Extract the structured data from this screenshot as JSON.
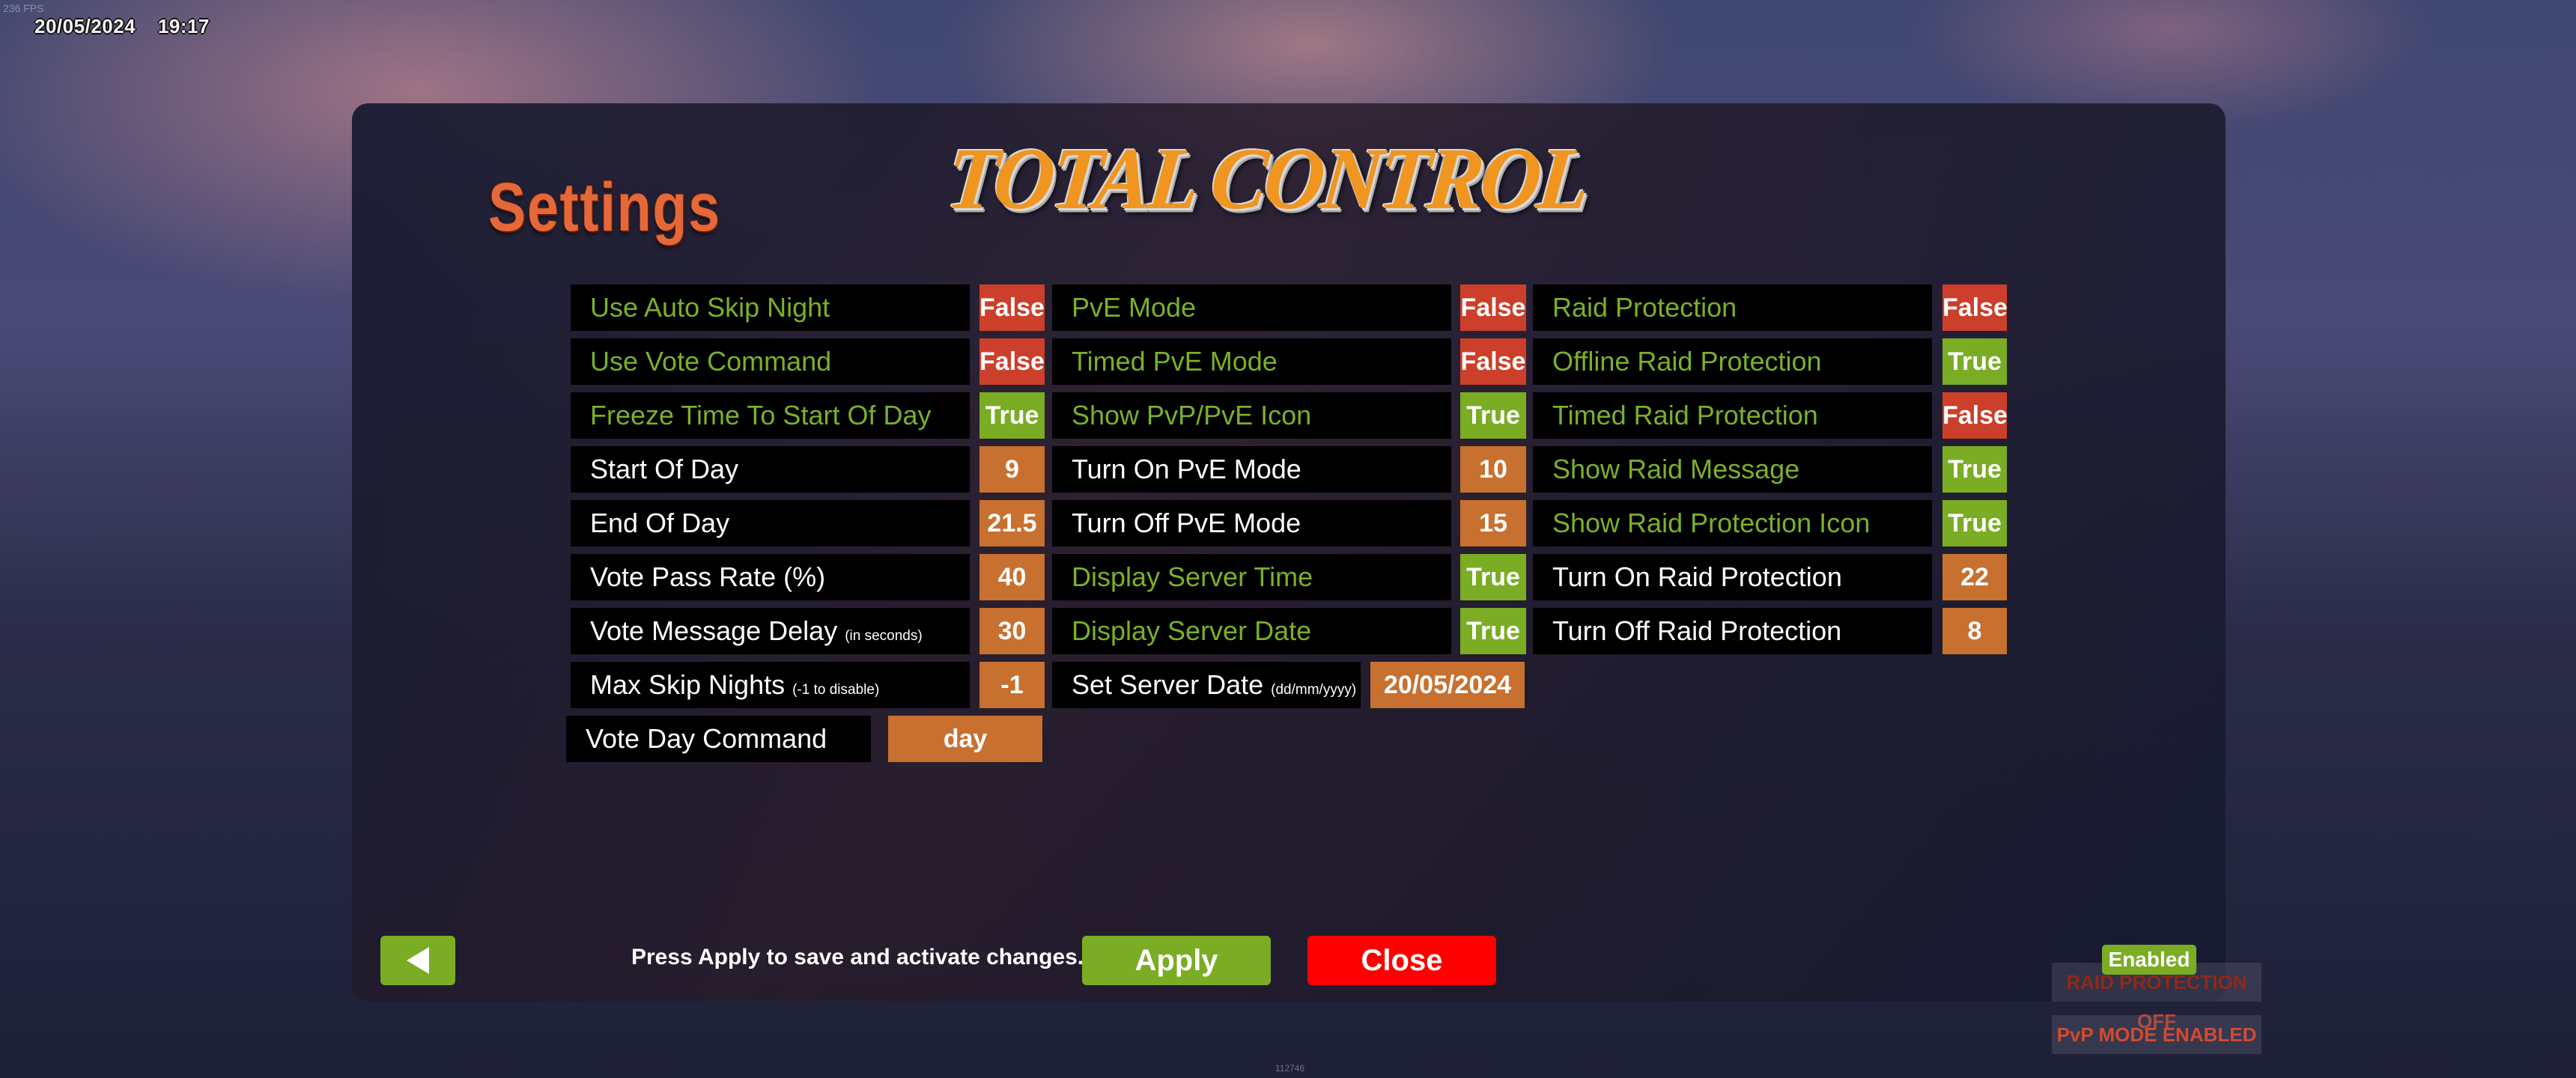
{
  "hud": {
    "fps": "236 FPS",
    "date": "20/05/2024",
    "time": "19:17"
  },
  "panel": {
    "title": "Settings",
    "logo": "TOTAL CONTROL"
  },
  "columns": [
    {
      "rows": [
        {
          "label": "Use Auto Skip Night",
          "value": "False",
          "kind": "false",
          "label_color": "green"
        },
        {
          "label": "Use Vote Command",
          "value": "False",
          "kind": "false",
          "label_color": "green"
        },
        {
          "label": "Freeze Time To Start Of Day",
          "value": "True",
          "kind": "true",
          "label_color": "green"
        },
        {
          "label": "Start Of Day",
          "value": "9",
          "kind": "num",
          "label_color": "white"
        },
        {
          "label": "End Of Day",
          "value": "21.5",
          "kind": "num",
          "label_color": "white"
        },
        {
          "label": "Vote Pass Rate (%)",
          "value": "40",
          "kind": "num",
          "label_color": "white"
        },
        {
          "label": "Vote Message Delay",
          "note": "(in seconds)",
          "value": "30",
          "kind": "num",
          "label_color": "white"
        },
        {
          "label": "Max Skip Nights",
          "note": "(-1 to disable)",
          "value": "-1",
          "kind": "num",
          "label_color": "white"
        }
      ],
      "wide_row": {
        "label": "Vote Day Command",
        "value": "day"
      }
    },
    {
      "rows": [
        {
          "label": "PvE Mode",
          "value": "False",
          "kind": "false",
          "label_color": "green"
        },
        {
          "label": "Timed PvE Mode",
          "value": "False",
          "kind": "false",
          "label_color": "green"
        },
        {
          "label": "Show PvP/PvE Icon",
          "value": "True",
          "kind": "true",
          "label_color": "green"
        },
        {
          "label": "Turn On PvE Mode",
          "value": "10",
          "kind": "num",
          "label_color": "white"
        },
        {
          "label": "Turn Off PvE Mode",
          "value": "15",
          "kind": "num",
          "label_color": "white"
        },
        {
          "label": "Display Server Time",
          "value": "True",
          "kind": "true",
          "label_color": "green"
        },
        {
          "label": "Display Server Date",
          "value": "True",
          "kind": "true",
          "label_color": "green"
        }
      ],
      "wide_row": {
        "label": "Set Server Date",
        "note": "(dd/mm/yyyy)",
        "value": "20/05/2024"
      }
    },
    {
      "rows": [
        {
          "label": "Raid Protection",
          "value": "False",
          "kind": "false",
          "label_color": "green"
        },
        {
          "label": "Offline Raid Protection",
          "value": "True",
          "kind": "true",
          "label_color": "green"
        },
        {
          "label": "Timed Raid Protection",
          "value": "False",
          "kind": "false",
          "label_color": "green"
        },
        {
          "label": "Show Raid Message",
          "value": "True",
          "kind": "true",
          "label_color": "green"
        },
        {
          "label": "Show Raid Protection Icon",
          "value": "True",
          "kind": "true",
          "label_color": "green"
        },
        {
          "label": "Turn On Raid Protection",
          "value": "22",
          "kind": "num",
          "label_color": "white"
        },
        {
          "label": "Turn Off Raid Protection",
          "value": "8",
          "kind": "num",
          "label_color": "white"
        }
      ]
    }
  ],
  "footer": {
    "hint": "Press Apply to save and activate changes.",
    "back_icon": "triangle-left",
    "apply": "Apply",
    "close": "Close"
  },
  "status": {
    "enabled_badge": "Enabled",
    "raid_text": "RAID PROTECTION",
    "raid_state": "OFF",
    "pvp_text": "PvP MODE ENABLED"
  },
  "build_code": "112746",
  "colors": {
    "false": "#cc3f2a",
    "true": "#7aac24",
    "number": "#c8702f",
    "label_green": "#7ab02a",
    "close": "#ff0000",
    "title": "#e4683a",
    "logo": "#f0951f"
  }
}
